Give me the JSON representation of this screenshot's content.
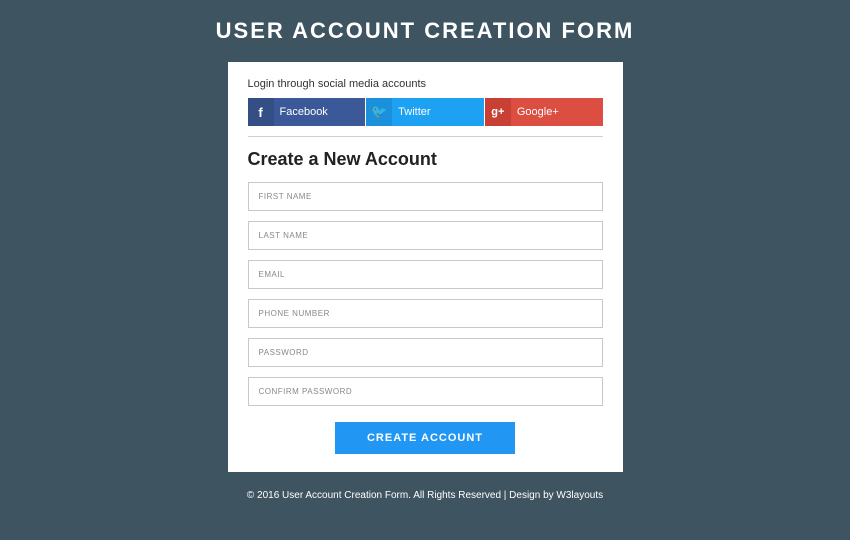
{
  "page": {
    "title": "USER ACCOUNT CREATION FORM"
  },
  "social": {
    "label": "Login through social media accounts",
    "facebook": {
      "icon": "f",
      "label": "Facebook"
    },
    "twitter": {
      "icon": "🐦",
      "label": "Twitter"
    },
    "googleplus": {
      "icon": "g+",
      "label": "Google+"
    }
  },
  "form": {
    "heading": "Create a New Account",
    "fields": {
      "first_name": "FIRST NAME",
      "last_name": "LAST NAME",
      "email": "EMAIL",
      "phone": "PHONE NUMBER",
      "password": "PASSWORD",
      "confirm_password": "CONFIRM PASSWORD"
    },
    "submit": "CREATE ACCOUNT"
  },
  "footer": {
    "text": "© 2016 User Account Creation Form. All Rights Reserved | Design by ",
    "link": "W3layouts"
  }
}
